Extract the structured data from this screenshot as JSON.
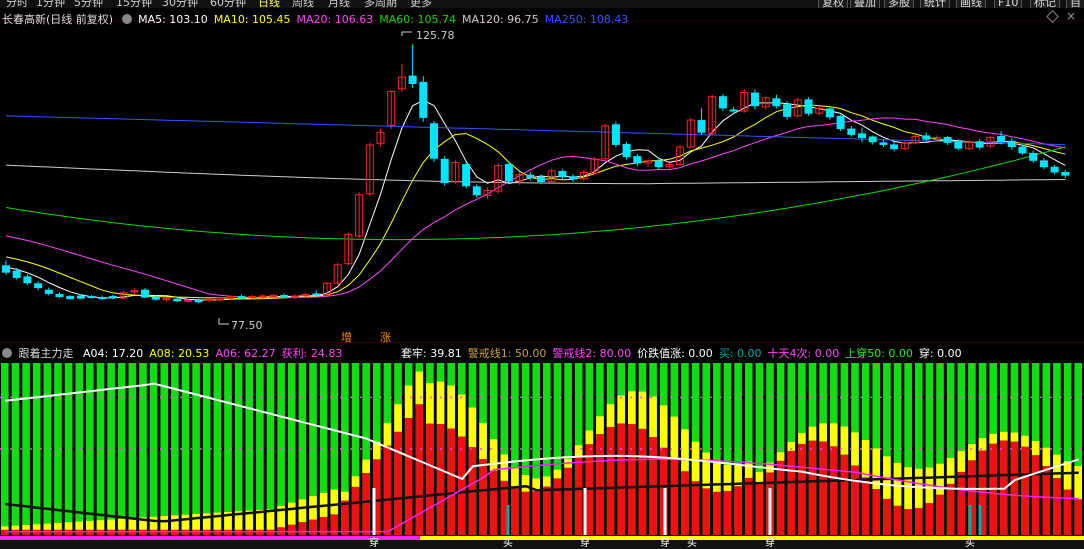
{
  "topbar": {
    "periods": [
      "分时",
      "1分钟",
      "5分钟",
      "15分钟",
      "30分钟",
      "60分钟",
      "日线",
      "周线",
      "月线",
      "多周期",
      "更多"
    ],
    "active_period": "日线",
    "buttons": [
      "复权",
      "叠加",
      "多股",
      "统计",
      "画线",
      "F10",
      "标记",
      "自"
    ]
  },
  "main_header": {
    "title": "长春高新(日线 前复权)",
    "ma": [
      {
        "label": "MA5: 103.10",
        "color": "#ffffff"
      },
      {
        "label": "MA10: 105.45",
        "color": "#ffff00"
      },
      {
        "label": "MA20: 106.63",
        "color": "#ff44ff"
      },
      {
        "label": "MA60: 105.74",
        "color": "#00dd00"
      },
      {
        "label": "MA120: 96.75",
        "color": "#cccccc"
      },
      {
        "label": "MA250: 108.43",
        "color": "#3355ff"
      }
    ]
  },
  "annotations": {
    "high": "125.78",
    "low": "77.50",
    "tag1": "增",
    "tag2": "涨"
  },
  "colors": {
    "up": "#ff2222",
    "down": "#00e5ff",
    "green": "#11dd11",
    "yellow": "#ffff00",
    "red": "#ee1111",
    "magenta": "#ff22ff"
  },
  "chart_data": {
    "type": "candlestick",
    "y_range": [
      70,
      130
    ],
    "ohlc": [
      [
        84.0,
        85.0,
        82.3,
        82.8
      ],
      [
        83.0,
        83.6,
        81.4,
        81.8
      ],
      [
        81.9,
        82.4,
        80.4,
        80.8
      ],
      [
        80.6,
        81.1,
        79.4,
        79.9
      ],
      [
        79.4,
        79.9,
        78.4,
        78.8
      ],
      [
        78.6,
        79.0,
        77.9,
        78.2
      ],
      [
        78.2,
        78.5,
        77.6,
        77.8
      ],
      [
        78.3,
        78.6,
        77.7,
        77.9
      ],
      [
        78.2,
        78.5,
        77.8,
        78.0
      ],
      [
        78.0,
        78.4,
        77.6,
        77.9
      ],
      [
        78.2,
        78.6,
        77.7,
        78.0
      ],
      [
        77.9,
        79.3,
        77.6,
        78.9
      ],
      [
        79.1,
        79.8,
        78.6,
        79.3
      ],
      [
        79.4,
        79.8,
        77.9,
        78.1
      ],
      [
        78.1,
        78.5,
        77.4,
        77.7
      ],
      [
        77.6,
        78.1,
        77.2,
        77.8
      ],
      [
        77.7,
        78.2,
        77.1,
        77.4
      ],
      [
        77.3,
        77.8,
        77.0,
        77.5
      ],
      [
        77.4,
        77.8,
        76.9,
        77.3
      ],
      [
        77.5,
        77.9,
        77.1,
        77.7
      ],
      [
        77.6,
        78.0,
        77.2,
        77.9
      ],
      [
        77.9,
        78.4,
        77.4,
        78.2
      ],
      [
        78.2,
        78.6,
        77.6,
        77.9
      ],
      [
        78.0,
        78.5,
        77.7,
        78.2
      ],
      [
        78.2,
        78.6,
        77.8,
        78.3
      ],
      [
        78.3,
        78.7,
        77.9,
        78.4
      ],
      [
        78.4,
        78.8,
        77.8,
        78.1
      ],
      [
        78.1,
        78.6,
        77.7,
        78.3
      ],
      [
        78.4,
        79.0,
        78.0,
        78.6
      ],
      [
        78.7,
        79.3,
        78.1,
        78.5
      ],
      [
        78.5,
        80.9,
        78.3,
        80.7
      ],
      [
        80.7,
        84.6,
        80.4,
        84.2
      ],
      [
        84.4,
        90.3,
        84.1,
        89.9
      ],
      [
        89.6,
        97.9,
        89.3,
        97.4
      ],
      [
        97.6,
        107.2,
        97.2,
        106.8
      ],
      [
        107.1,
        109.8,
        106.5,
        109.2
      ],
      [
        110.5,
        117.1,
        109.8,
        116.9
      ],
      [
        117.4,
        122.1,
        116.8,
        119.6
      ],
      [
        119.8,
        125.78,
        117.6,
        118.4
      ],
      [
        118.6,
        119.8,
        111.2,
        112.0
      ],
      [
        110.8,
        111.3,
        103.6,
        104.3
      ],
      [
        104.1,
        104.7,
        99.1,
        99.7
      ],
      [
        99.8,
        104.0,
        99.4,
        103.5
      ],
      [
        103.1,
        103.6,
        98.6,
        99.1
      ],
      [
        98.9,
        99.4,
        96.8,
        97.4
      ],
      [
        97.3,
        98.8,
        96.6,
        98.2
      ],
      [
        98.1,
        103.4,
        97.6,
        102.9
      ],
      [
        103.1,
        103.6,
        99.4,
        100.0
      ],
      [
        100.0,
        101.7,
        99.3,
        101.2
      ],
      [
        101.1,
        101.7,
        100.1,
        100.7
      ],
      [
        100.7,
        101.2,
        99.4,
        99.9
      ],
      [
        99.9,
        102.3,
        99.6,
        101.9
      ],
      [
        101.8,
        102.3,
        100.3,
        100.8
      ],
      [
        100.8,
        101.3,
        99.8,
        100.4
      ],
      [
        100.4,
        102.1,
        100.1,
        101.6
      ],
      [
        101.5,
        104.5,
        101.2,
        104.1
      ],
      [
        104.2,
        110.8,
        104.0,
        110.4
      ],
      [
        110.6,
        111.2,
        106.4,
        106.9
      ],
      [
        106.9,
        107.4,
        104.0,
        104.6
      ],
      [
        104.6,
        105.1,
        102.8,
        103.4
      ],
      [
        103.4,
        104.1,
        102.7,
        103.8
      ],
      [
        103.8,
        104.3,
        102.1,
        102.7
      ],
      [
        102.7,
        103.5,
        102.3,
        103.1
      ],
      [
        103.1,
        106.8,
        102.9,
        106.4
      ],
      [
        106.4,
        111.9,
        106.2,
        111.5
      ],
      [
        111.4,
        113.7,
        108.7,
        109.2
      ],
      [
        109.0,
        116.3,
        108.6,
        115.9
      ],
      [
        115.9,
        116.4,
        113.2,
        113.8
      ],
      [
        113.4,
        114.0,
        112.6,
        113.2
      ],
      [
        113.2,
        117.3,
        112.9,
        116.7
      ],
      [
        116.6,
        117.3,
        113.5,
        114.2
      ],
      [
        114.0,
        115.9,
        113.5,
        115.7
      ],
      [
        115.5,
        116.3,
        113.7,
        114.2
      ],
      [
        114.4,
        115.1,
        111.6,
        112.2
      ],
      [
        112.3,
        115.7,
        112.0,
        115.3
      ],
      [
        115.3,
        115.8,
        112.3,
        112.8
      ],
      [
        112.8,
        114.1,
        112.4,
        113.7
      ],
      [
        113.6,
        114.0,
        111.6,
        112.1
      ],
      [
        112.2,
        112.5,
        109.4,
        109.9
      ],
      [
        109.8,
        110.4,
        108.4,
        108.8
      ],
      [
        108.9,
        110.1,
        107.3,
        108.2
      ],
      [
        108.3,
        108.6,
        106.9,
        107.4
      ],
      [
        107.2,
        107.8,
        106.4,
        106.9
      ],
      [
        106.8,
        107.4,
        105.6,
        106.1
      ],
      [
        106.1,
        107.5,
        105.8,
        107.2
      ],
      [
        107.2,
        108.7,
        106.9,
        108.4
      ],
      [
        108.5,
        109.2,
        107.5,
        107.9
      ],
      [
        107.8,
        108.6,
        107.3,
        108.2
      ],
      [
        108.2,
        108.5,
        106.8,
        107.3
      ],
      [
        107.4,
        107.9,
        105.8,
        106.2
      ],
      [
        106.1,
        107.7,
        105.8,
        107.4
      ],
      [
        107.4,
        107.9,
        105.9,
        106.4
      ],
      [
        106.6,
        108.5,
        106.2,
        108.2
      ],
      [
        108.4,
        109.4,
        106.9,
        107.4
      ],
      [
        107.5,
        108.1,
        105.9,
        106.5
      ],
      [
        106.4,
        106.9,
        104.9,
        105.3
      ],
      [
        105.2,
        105.7,
        103.4,
        103.9
      ],
      [
        103.8,
        104.3,
        102.2,
        102.7
      ],
      [
        102.6,
        103.1,
        101.2,
        101.7
      ],
      [
        101.6,
        102.1,
        100.6,
        101.1
      ]
    ],
    "ma_series": [
      "MA5",
      "MA10",
      "MA20",
      "MA60",
      "MA120",
      "MA250"
    ]
  },
  "ind_header": {
    "title": "跟着主力走",
    "items": [
      {
        "label": "A04: 17.20",
        "color": "#ffffff"
      },
      {
        "label": "A08: 20.53",
        "color": "#ffff00"
      },
      {
        "label": "A06: 62.27",
        "color": "#ff44ff"
      },
      {
        "label": "获利: 24.83",
        "color": "#ff44ff"
      },
      {
        "label": "套牢: 39.81",
        "color": "#ffffff"
      },
      {
        "label": "警戒线1: 50.00",
        "color": "#c8a040"
      },
      {
        "label": "警戒线2: 80.00",
        "color": "#ff44ff"
      },
      {
        "label": "价跌值涨: 0.00",
        "color": "#ffffff"
      },
      {
        "label": "买: 0.00",
        "color": "#00aaaa"
      },
      {
        "label": "十天4次: 0.00",
        "color": "#ff44ff"
      },
      {
        "label": "上穿50: 0.00",
        "color": "#22ee22"
      },
      {
        "label": "穿: 0.00",
        "color": "#ffffff"
      }
    ],
    "bottom_labels": [
      "穿",
      "买",
      "穿",
      "穿",
      "买",
      "穿",
      "买"
    ]
  }
}
